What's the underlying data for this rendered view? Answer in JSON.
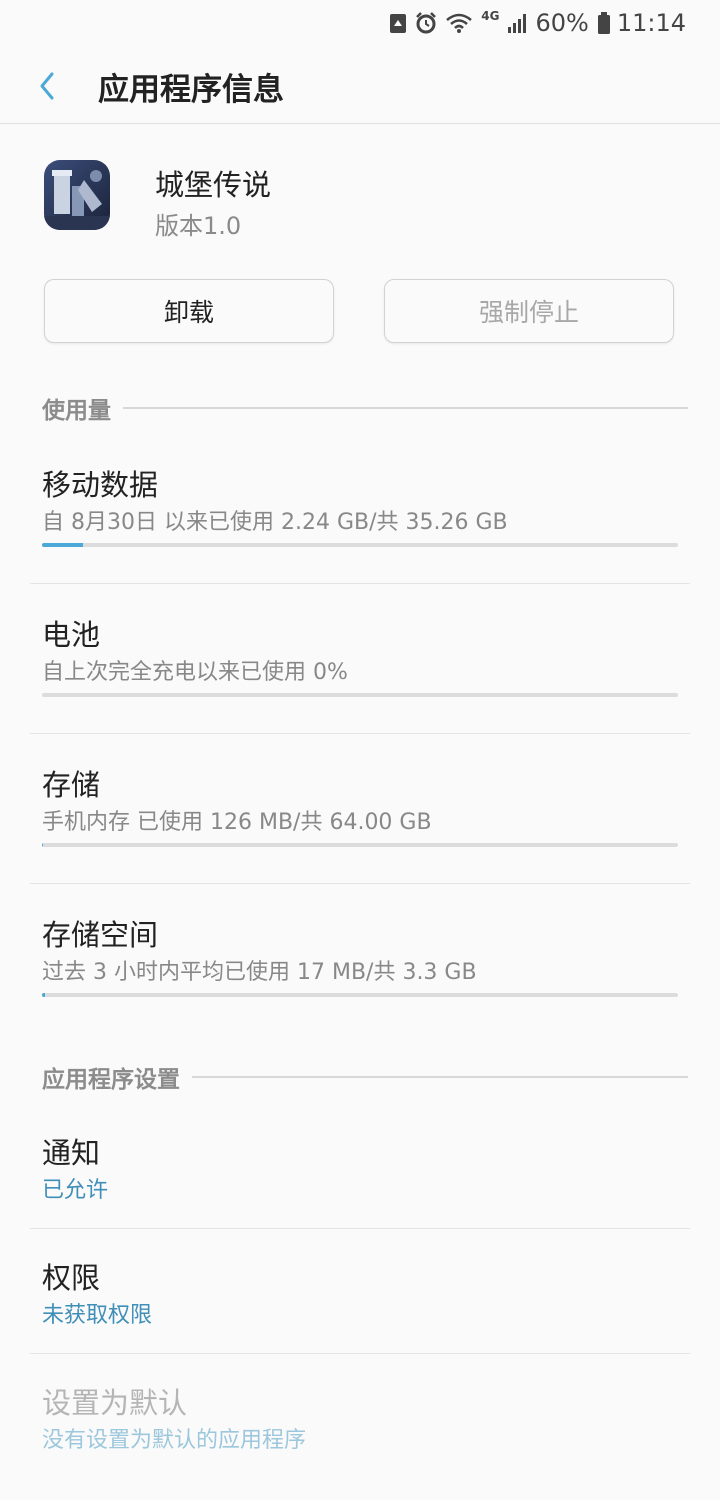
{
  "status_bar": {
    "network": "4G",
    "battery": "60%",
    "time": "11:14"
  },
  "app_bar": {
    "title": "应用程序信息"
  },
  "app": {
    "name": "城堡传说",
    "version": "版本1.0"
  },
  "actions": {
    "uninstall": "卸载",
    "force_stop": "强制停止"
  },
  "usage": {
    "header": "使用量",
    "items": [
      {
        "title": "移动数据",
        "subtitle": "自 8月30日 以来已使用 2.24 GB/共 35.26 GB",
        "progress": 0.064
      },
      {
        "title": "电池",
        "subtitle": "自上次完全充电以来已使用 0%",
        "progress": 0.0
      },
      {
        "title": "存储",
        "subtitle": "手机内存 已使用 126 MB/共 64.00 GB",
        "progress": 0.002
      },
      {
        "title": "存储空间",
        "subtitle": "过去 3 小时内平均已使用 17 MB/共 3.3 GB",
        "progress": 0.005
      }
    ]
  },
  "settings": {
    "header": "应用程序设置",
    "items": [
      {
        "title": "通知",
        "subtitle": "已允许"
      },
      {
        "title": "权限",
        "subtitle": "未获取权限"
      },
      {
        "title": "设置为默认",
        "subtitle": "没有设置为默认的应用程序"
      }
    ]
  },
  "colors": {
    "accent": "#4aa9d6",
    "link": "#3f8fb8",
    "background": "#fafafa"
  }
}
